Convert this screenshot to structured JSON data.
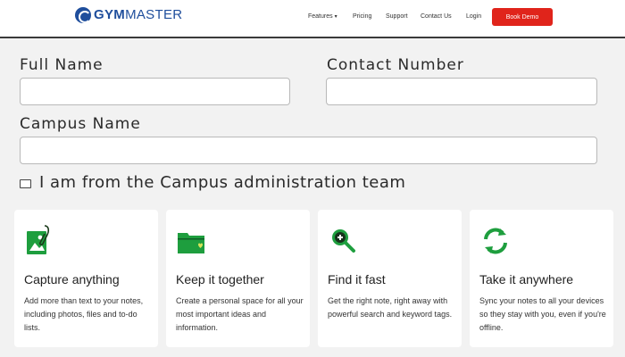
{
  "brand": {
    "gym": "GYM",
    "master": "MASTER"
  },
  "nav": {
    "features": "Features",
    "pricing": "Pricing",
    "support": "Support",
    "contact": "Contact Us",
    "login": "Login",
    "demo": "Book Demo"
  },
  "form": {
    "full_name_label": "Full Name",
    "full_name_value": "",
    "contact_label": "Contact Number",
    "contact_value": "",
    "campus_label": "Campus Name",
    "campus_value": "",
    "checkbox_label": "I am from the Campus administration team",
    "checkbox_checked": false
  },
  "features": [
    {
      "title": "Capture anything",
      "text": "Add more than text to your notes, including photos, files and to-do lists.",
      "icon": "image-clip-icon"
    },
    {
      "title": "Keep it together",
      "text": "Create a personal space for all your most important ideas and information.",
      "icon": "folder-heart-icon"
    },
    {
      "title": "Find it fast",
      "text": "Get the right note, right away with powerful search and keyword tags.",
      "icon": "search-plus-icon"
    },
    {
      "title": "Take it anywhere",
      "text": "Sync your notes to all your devices so they stay with you, even if you're offline.",
      "icon": "sync-icon"
    }
  ],
  "colors": {
    "brand_blue": "#1f4e9c",
    "cta_red": "#e0241b",
    "icon_green": "#1e9e3e",
    "background": "#f2f2f2"
  }
}
